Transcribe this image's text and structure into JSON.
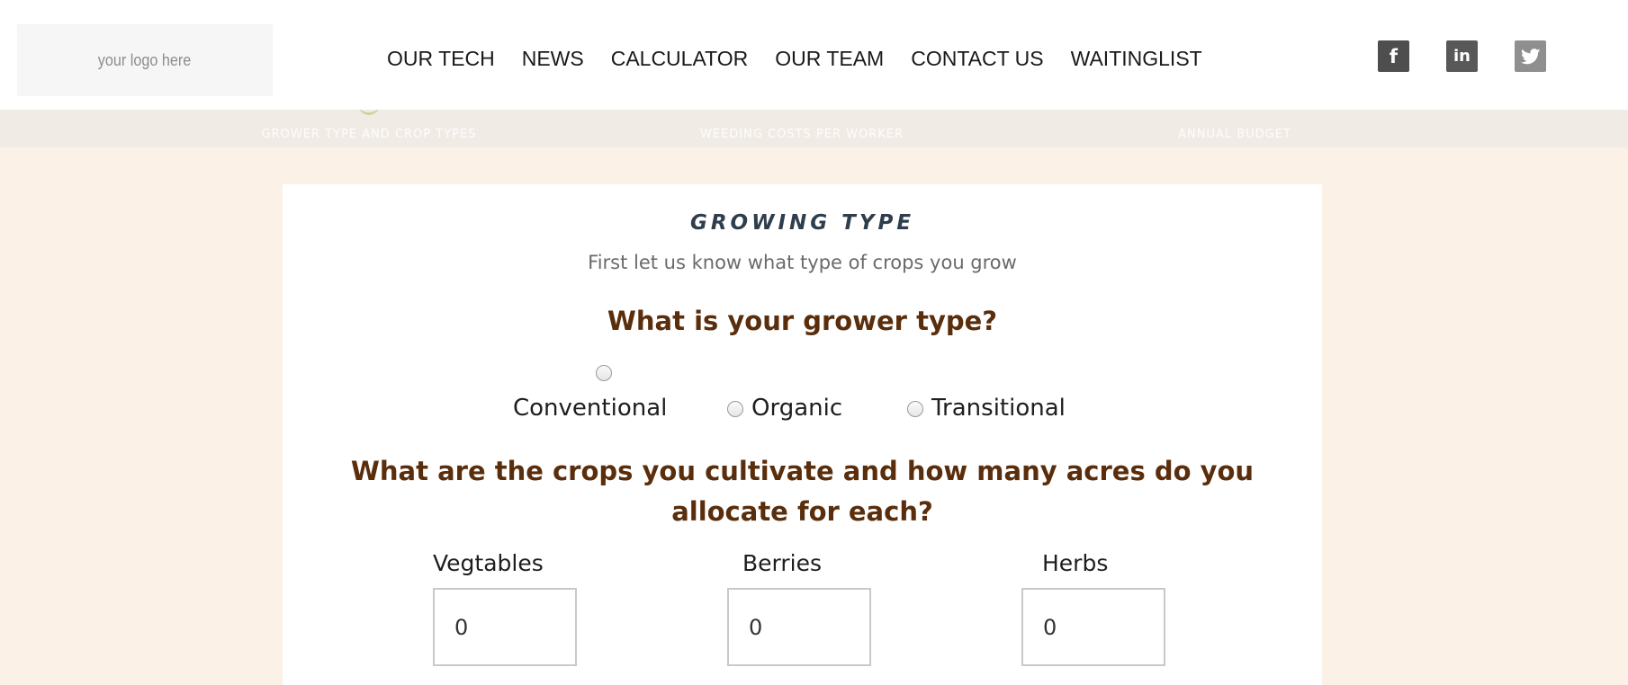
{
  "header": {
    "logo_text": "your logo here",
    "nav": [
      "OUR TECH",
      "NEWS",
      "CALCULATOR",
      "OUR TEAM",
      "CONTACT US",
      "WAITINGLIST"
    ],
    "social": [
      {
        "name": "facebook",
        "glyph": "f"
      },
      {
        "name": "linkedin",
        "glyph": "in"
      },
      {
        "name": "twitter",
        "glyph": ""
      }
    ]
  },
  "steps": [
    "GROWER TYPE AND CROP TYPES",
    "WEEDING COSTS PER WORKER",
    "ANNUAL BUDGET"
  ],
  "form": {
    "section_title": "GROWING TYPE",
    "subtitle": "First let us know what type of crops you grow",
    "grower_question": "What is your grower type?",
    "grower_options": [
      "Conventional",
      "Organic",
      "Transitional"
    ],
    "crops_question": "What are the crops you cultivate and how many acres do you allocate for each?",
    "crops": [
      {
        "label": "Vegtables",
        "value": "0"
      },
      {
        "label": "Berries",
        "value": "0"
      },
      {
        "label": "Herbs",
        "value": "0"
      }
    ]
  },
  "colors": {
    "page_bg": "#fbf1e7",
    "question_text": "#5a2e0c",
    "section_title": "#2f3e4d",
    "step_accent": "#cbd59d"
  }
}
